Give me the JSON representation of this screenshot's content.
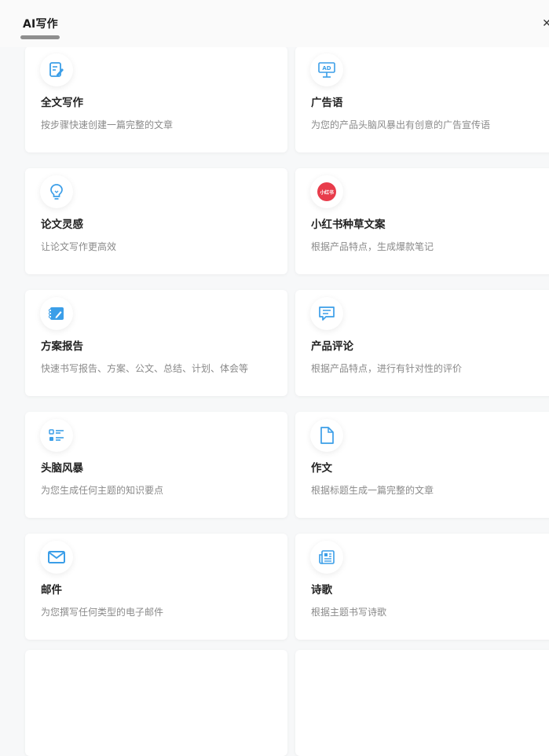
{
  "header": {
    "title": "AI写作",
    "close_icon": "close-icon"
  },
  "colors": {
    "icon_blue": "#3b9ee8",
    "xhs_red": "#e83c4b",
    "tab_underline": "#8e8e8e"
  },
  "cards": [
    {
      "name": "全文写作",
      "desc": "按步骤快速创建一篇完整的文章",
      "icon": "edit-document-icon"
    },
    {
      "name": "广告语",
      "desc": "为您的产品头脑风暴出有创意的广告宣传语",
      "icon": "ad-board-icon"
    },
    {
      "name": "论文灵感",
      "desc": "让论文写作更高效",
      "icon": "lightbulb-icon"
    },
    {
      "name": "小红书种草文案",
      "desc": "根据产品特点，生成爆款笔记",
      "icon": "xiaohongshu-icon",
      "icon_text": "小红书"
    },
    {
      "name": "方案报告",
      "desc": "快速书写报告、方案、公文、总结、计划、体会等",
      "icon": "notebook-pen-icon"
    },
    {
      "name": "产品评论",
      "desc": "根据产品特点，进行有针对性的评价",
      "icon": "comment-bubble-icon"
    },
    {
      "name": "头脑风暴",
      "desc": "为您生成任何主题的知识要点",
      "icon": "list-icon"
    },
    {
      "name": "作文",
      "desc": "根据标题生成一篇完整的文章",
      "icon": "file-icon"
    },
    {
      "name": "邮件",
      "desc": "为您撰写任何类型的电子邮件",
      "icon": "mail-icon"
    },
    {
      "name": "诗歌",
      "desc": "根据主题书写诗歌",
      "icon": "newspaper-icon"
    }
  ]
}
